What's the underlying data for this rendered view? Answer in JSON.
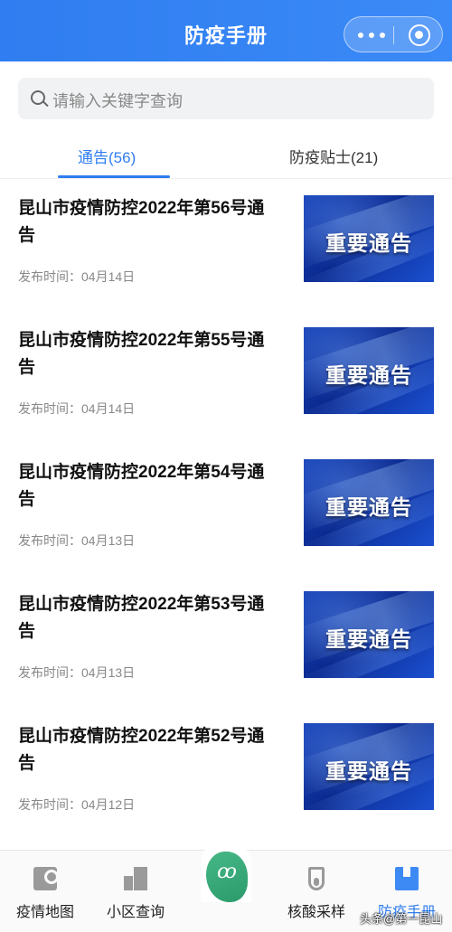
{
  "header": {
    "title": "防疫手册",
    "more_icon": "more-dots-icon",
    "close_icon": "target-close-icon",
    "color": "#2f7df0"
  },
  "search": {
    "placeholder": "请输入关键字查询",
    "icon": "search-icon"
  },
  "tabs": [
    {
      "label": "通告(56)",
      "active": true
    },
    {
      "label": "防疫贴士(21)",
      "active": false
    }
  ],
  "notices": [
    {
      "title": "昆山市疫情防控2022年第56号通告",
      "date_label": "发布时间：04月14日",
      "thumb_text": "重要通告"
    },
    {
      "title": "昆山市疫情防控2022年第55号通告",
      "date_label": "发布时间：04月14日",
      "thumb_text": "重要通告"
    },
    {
      "title": "昆山市疫情防控2022年第54号通告",
      "date_label": "发布时间：04月13日",
      "thumb_text": "重要通告"
    },
    {
      "title": "昆山市疫情防控2022年第53号通告",
      "date_label": "发布时间：04月13日",
      "thumb_text": "重要通告"
    },
    {
      "title": "昆山市疫情防控2022年第52号通告",
      "date_label": "发布时间：04月12日",
      "thumb_text": "重要通告"
    }
  ],
  "bottom_nav": [
    {
      "label": "疫情地图",
      "icon": "map-pin-icon",
      "active": false
    },
    {
      "label": "小区查询",
      "icon": "building-icon",
      "active": false
    },
    {
      "label": "",
      "icon": "kunshan-logo-icon",
      "active": false
    },
    {
      "label": "核酸采样",
      "icon": "test-tube-icon",
      "active": false
    },
    {
      "label": "防疫手册",
      "icon": "book-icon",
      "active": true
    }
  ],
  "watermark": "头条@第一昆山"
}
